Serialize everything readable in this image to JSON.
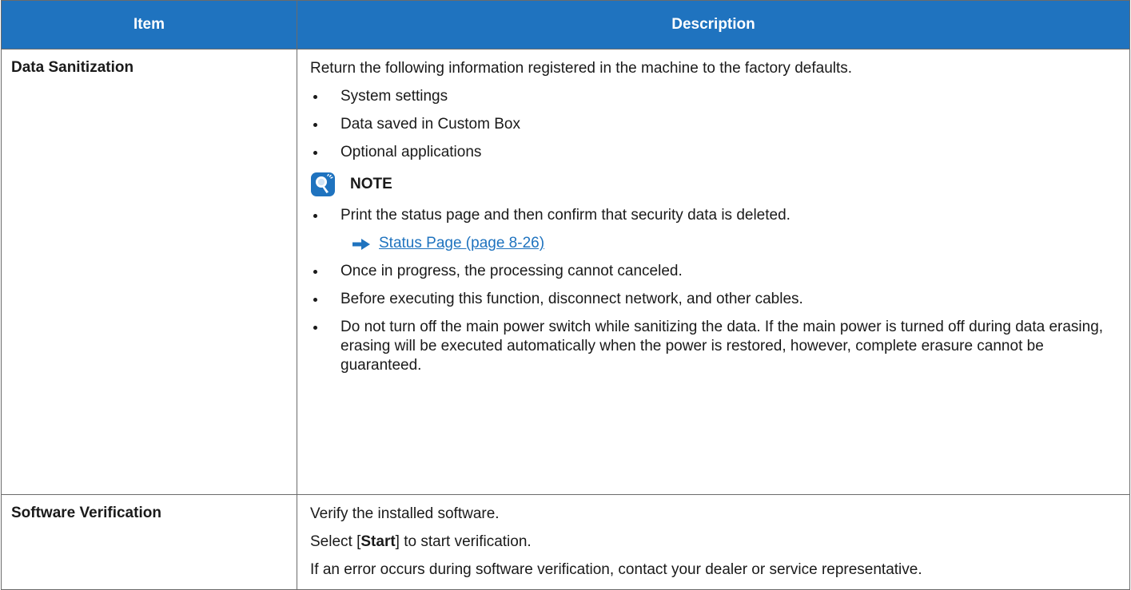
{
  "table": {
    "headers": [
      "Item",
      "Description"
    ],
    "rows": [
      {
        "item": "Data Sanitization",
        "intro": "Return the following information registered in the machine to the factory defaults.",
        "bullets": [
          "System settings",
          "Data saved in Custom Box",
          "Optional applications"
        ],
        "note": {
          "label": "NOTE",
          "icon": "lightbulb-note-icon",
          "bullet1": "Print the status page and then confirm that security data is deleted.",
          "link": "Status Page (page 8-26)",
          "bullet2": "Once in progress, the processing cannot canceled.",
          "bullet3": "Before executing this function, disconnect network, and other cables.",
          "bullet4": "Do not turn off the main power switch while sanitizing the data. If the main power is turned off during data erasing, erasing will be executed automatically when the power is restored, however, complete erasure cannot be guaranteed."
        }
      },
      {
        "item": "Software Verification",
        "p1": "Verify the installed software.",
        "p2_pre": "Select [",
        "p2_bold": "Start",
        "p2_post": "] to start verification.",
        "p3": "If an error occurs during software verification, contact your dealer or service representative."
      }
    ]
  },
  "colors": {
    "header_bg": "#1f73bf",
    "link": "#1f73bf",
    "border": "#6b6b6b"
  }
}
